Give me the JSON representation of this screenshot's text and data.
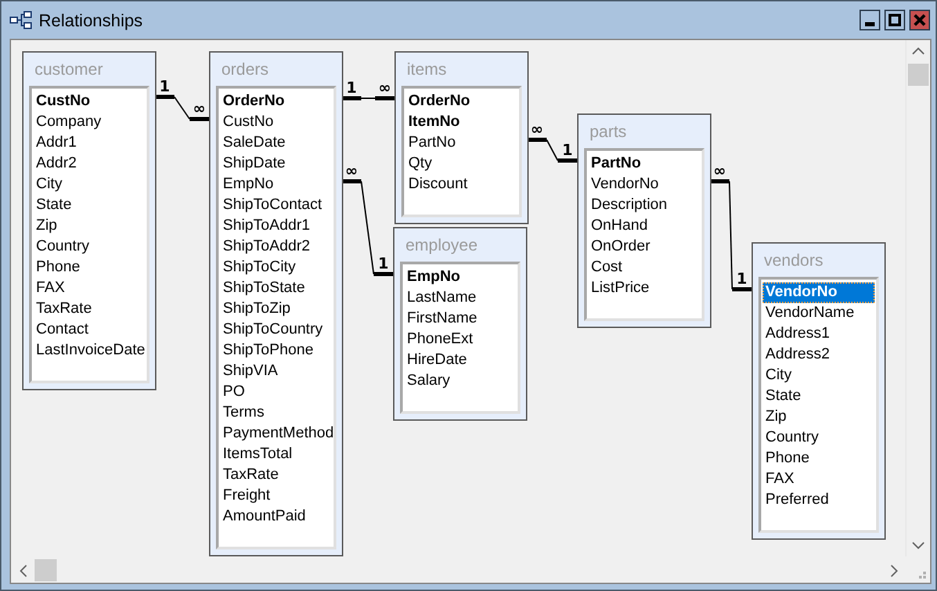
{
  "window": {
    "title": "Relationships"
  },
  "tables": [
    {
      "name": "customer",
      "fields": [
        {
          "name": "CustNo",
          "key": true,
          "selected": false
        },
        {
          "name": "Company",
          "key": false,
          "selected": false
        },
        {
          "name": "Addr1",
          "key": false,
          "selected": false
        },
        {
          "name": "Addr2",
          "key": false,
          "selected": false
        },
        {
          "name": "City",
          "key": false,
          "selected": false
        },
        {
          "name": "State",
          "key": false,
          "selected": false
        },
        {
          "name": "Zip",
          "key": false,
          "selected": false
        },
        {
          "name": "Country",
          "key": false,
          "selected": false
        },
        {
          "name": "Phone",
          "key": false,
          "selected": false
        },
        {
          "name": "FAX",
          "key": false,
          "selected": false
        },
        {
          "name": "TaxRate",
          "key": false,
          "selected": false
        },
        {
          "name": "Contact",
          "key": false,
          "selected": false
        },
        {
          "name": "LastInvoiceDate",
          "key": false,
          "selected": false
        }
      ]
    },
    {
      "name": "orders",
      "fields": [
        {
          "name": "OrderNo",
          "key": true,
          "selected": false
        },
        {
          "name": "CustNo",
          "key": false,
          "selected": false
        },
        {
          "name": "SaleDate",
          "key": false,
          "selected": false
        },
        {
          "name": "ShipDate",
          "key": false,
          "selected": false
        },
        {
          "name": "EmpNo",
          "key": false,
          "selected": false
        },
        {
          "name": "ShipToContact",
          "key": false,
          "selected": false
        },
        {
          "name": "ShipToAddr1",
          "key": false,
          "selected": false
        },
        {
          "name": "ShipToAddr2",
          "key": false,
          "selected": false
        },
        {
          "name": "ShipToCity",
          "key": false,
          "selected": false
        },
        {
          "name": "ShipToState",
          "key": false,
          "selected": false
        },
        {
          "name": "ShipToZip",
          "key": false,
          "selected": false
        },
        {
          "name": "ShipToCountry",
          "key": false,
          "selected": false
        },
        {
          "name": "ShipToPhone",
          "key": false,
          "selected": false
        },
        {
          "name": "ShipVIA",
          "key": false,
          "selected": false
        },
        {
          "name": "PO",
          "key": false,
          "selected": false
        },
        {
          "name": "Terms",
          "key": false,
          "selected": false
        },
        {
          "name": "PaymentMethod",
          "key": false,
          "selected": false
        },
        {
          "name": "ItemsTotal",
          "key": false,
          "selected": false
        },
        {
          "name": "TaxRate",
          "key": false,
          "selected": false
        },
        {
          "name": "Freight",
          "key": false,
          "selected": false
        },
        {
          "name": "AmountPaid",
          "key": false,
          "selected": false
        }
      ]
    },
    {
      "name": "items",
      "fields": [
        {
          "name": "OrderNo",
          "key": true,
          "selected": false
        },
        {
          "name": "ItemNo",
          "key": true,
          "selected": false
        },
        {
          "name": "PartNo",
          "key": false,
          "selected": false
        },
        {
          "name": "Qty",
          "key": false,
          "selected": false
        },
        {
          "name": "Discount",
          "key": false,
          "selected": false
        }
      ]
    },
    {
      "name": "employee",
      "fields": [
        {
          "name": "EmpNo",
          "key": true,
          "selected": false
        },
        {
          "name": "LastName",
          "key": false,
          "selected": false
        },
        {
          "name": "FirstName",
          "key": false,
          "selected": false
        },
        {
          "name": "PhoneExt",
          "key": false,
          "selected": false
        },
        {
          "name": "HireDate",
          "key": false,
          "selected": false
        },
        {
          "name": "Salary",
          "key": false,
          "selected": false
        }
      ]
    },
    {
      "name": "parts",
      "fields": [
        {
          "name": "PartNo",
          "key": true,
          "selected": false
        },
        {
          "name": "VendorNo",
          "key": false,
          "selected": false
        },
        {
          "name": "Description",
          "key": false,
          "selected": false
        },
        {
          "name": "OnHand",
          "key": false,
          "selected": false
        },
        {
          "name": "OnOrder",
          "key": false,
          "selected": false
        },
        {
          "name": "Cost",
          "key": false,
          "selected": false
        },
        {
          "name": "ListPrice",
          "key": false,
          "selected": false
        }
      ]
    },
    {
      "name": "vendors",
      "fields": [
        {
          "name": "VendorNo",
          "key": true,
          "selected": true
        },
        {
          "name": "VendorName",
          "key": false,
          "selected": false
        },
        {
          "name": "Address1",
          "key": false,
          "selected": false
        },
        {
          "name": "Address2",
          "key": false,
          "selected": false
        },
        {
          "name": "City",
          "key": false,
          "selected": false
        },
        {
          "name": "State",
          "key": false,
          "selected": false
        },
        {
          "name": "Zip",
          "key": false,
          "selected": false
        },
        {
          "name": "Country",
          "key": false,
          "selected": false
        },
        {
          "name": "Phone",
          "key": false,
          "selected": false
        },
        {
          "name": "FAX",
          "key": false,
          "selected": false
        },
        {
          "name": "Preferred",
          "key": false,
          "selected": false
        }
      ]
    }
  ],
  "relationships": [
    {
      "left_label": "1",
      "right_label": "∞"
    },
    {
      "left_label": "1",
      "right_label": "∞"
    },
    {
      "left_label": "∞",
      "right_label": "1"
    },
    {
      "left_label": "∞",
      "right_label": "1"
    },
    {
      "left_label": "∞",
      "right_label": "1"
    }
  ]
}
